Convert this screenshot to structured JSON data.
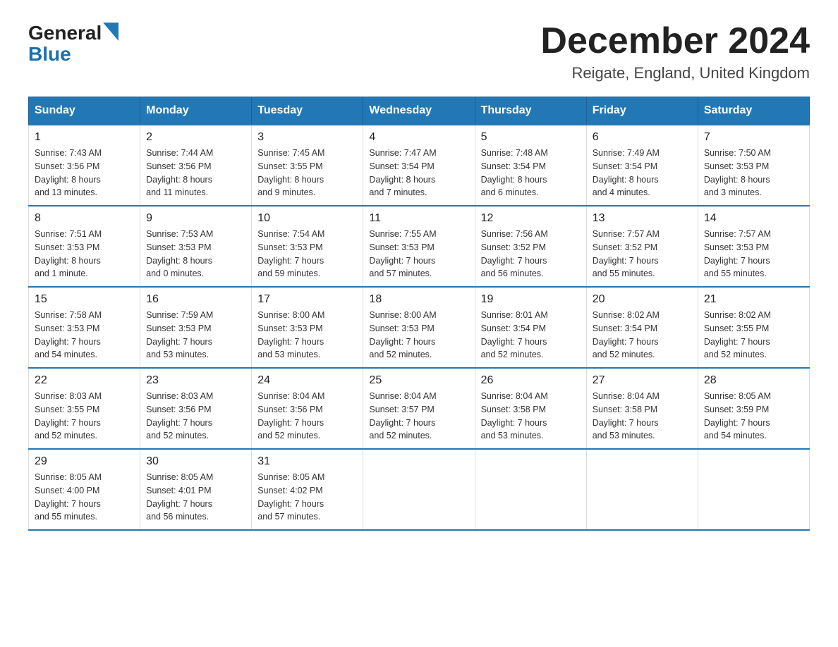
{
  "header": {
    "logo_general": "General",
    "logo_blue": "Blue",
    "month_year": "December 2024",
    "location": "Reigate, England, United Kingdom"
  },
  "days_of_week": [
    "Sunday",
    "Monday",
    "Tuesday",
    "Wednesday",
    "Thursday",
    "Friday",
    "Saturday"
  ],
  "weeks": [
    [
      {
        "num": "1",
        "info": "Sunrise: 7:43 AM\nSunset: 3:56 PM\nDaylight: 8 hours\nand 13 minutes."
      },
      {
        "num": "2",
        "info": "Sunrise: 7:44 AM\nSunset: 3:56 PM\nDaylight: 8 hours\nand 11 minutes."
      },
      {
        "num": "3",
        "info": "Sunrise: 7:45 AM\nSunset: 3:55 PM\nDaylight: 8 hours\nand 9 minutes."
      },
      {
        "num": "4",
        "info": "Sunrise: 7:47 AM\nSunset: 3:54 PM\nDaylight: 8 hours\nand 7 minutes."
      },
      {
        "num": "5",
        "info": "Sunrise: 7:48 AM\nSunset: 3:54 PM\nDaylight: 8 hours\nand 6 minutes."
      },
      {
        "num": "6",
        "info": "Sunrise: 7:49 AM\nSunset: 3:54 PM\nDaylight: 8 hours\nand 4 minutes."
      },
      {
        "num": "7",
        "info": "Sunrise: 7:50 AM\nSunset: 3:53 PM\nDaylight: 8 hours\nand 3 minutes."
      }
    ],
    [
      {
        "num": "8",
        "info": "Sunrise: 7:51 AM\nSunset: 3:53 PM\nDaylight: 8 hours\nand 1 minute."
      },
      {
        "num": "9",
        "info": "Sunrise: 7:53 AM\nSunset: 3:53 PM\nDaylight: 8 hours\nand 0 minutes."
      },
      {
        "num": "10",
        "info": "Sunrise: 7:54 AM\nSunset: 3:53 PM\nDaylight: 7 hours\nand 59 minutes."
      },
      {
        "num": "11",
        "info": "Sunrise: 7:55 AM\nSunset: 3:53 PM\nDaylight: 7 hours\nand 57 minutes."
      },
      {
        "num": "12",
        "info": "Sunrise: 7:56 AM\nSunset: 3:52 PM\nDaylight: 7 hours\nand 56 minutes."
      },
      {
        "num": "13",
        "info": "Sunrise: 7:57 AM\nSunset: 3:52 PM\nDaylight: 7 hours\nand 55 minutes."
      },
      {
        "num": "14",
        "info": "Sunrise: 7:57 AM\nSunset: 3:53 PM\nDaylight: 7 hours\nand 55 minutes."
      }
    ],
    [
      {
        "num": "15",
        "info": "Sunrise: 7:58 AM\nSunset: 3:53 PM\nDaylight: 7 hours\nand 54 minutes."
      },
      {
        "num": "16",
        "info": "Sunrise: 7:59 AM\nSunset: 3:53 PM\nDaylight: 7 hours\nand 53 minutes."
      },
      {
        "num": "17",
        "info": "Sunrise: 8:00 AM\nSunset: 3:53 PM\nDaylight: 7 hours\nand 53 minutes."
      },
      {
        "num": "18",
        "info": "Sunrise: 8:00 AM\nSunset: 3:53 PM\nDaylight: 7 hours\nand 52 minutes."
      },
      {
        "num": "19",
        "info": "Sunrise: 8:01 AM\nSunset: 3:54 PM\nDaylight: 7 hours\nand 52 minutes."
      },
      {
        "num": "20",
        "info": "Sunrise: 8:02 AM\nSunset: 3:54 PM\nDaylight: 7 hours\nand 52 minutes."
      },
      {
        "num": "21",
        "info": "Sunrise: 8:02 AM\nSunset: 3:55 PM\nDaylight: 7 hours\nand 52 minutes."
      }
    ],
    [
      {
        "num": "22",
        "info": "Sunrise: 8:03 AM\nSunset: 3:55 PM\nDaylight: 7 hours\nand 52 minutes."
      },
      {
        "num": "23",
        "info": "Sunrise: 8:03 AM\nSunset: 3:56 PM\nDaylight: 7 hours\nand 52 minutes."
      },
      {
        "num": "24",
        "info": "Sunrise: 8:04 AM\nSunset: 3:56 PM\nDaylight: 7 hours\nand 52 minutes."
      },
      {
        "num": "25",
        "info": "Sunrise: 8:04 AM\nSunset: 3:57 PM\nDaylight: 7 hours\nand 52 minutes."
      },
      {
        "num": "26",
        "info": "Sunrise: 8:04 AM\nSunset: 3:58 PM\nDaylight: 7 hours\nand 53 minutes."
      },
      {
        "num": "27",
        "info": "Sunrise: 8:04 AM\nSunset: 3:58 PM\nDaylight: 7 hours\nand 53 minutes."
      },
      {
        "num": "28",
        "info": "Sunrise: 8:05 AM\nSunset: 3:59 PM\nDaylight: 7 hours\nand 54 minutes."
      }
    ],
    [
      {
        "num": "29",
        "info": "Sunrise: 8:05 AM\nSunset: 4:00 PM\nDaylight: 7 hours\nand 55 minutes."
      },
      {
        "num": "30",
        "info": "Sunrise: 8:05 AM\nSunset: 4:01 PM\nDaylight: 7 hours\nand 56 minutes."
      },
      {
        "num": "31",
        "info": "Sunrise: 8:05 AM\nSunset: 4:02 PM\nDaylight: 7 hours\nand 57 minutes."
      },
      null,
      null,
      null,
      null
    ]
  ]
}
